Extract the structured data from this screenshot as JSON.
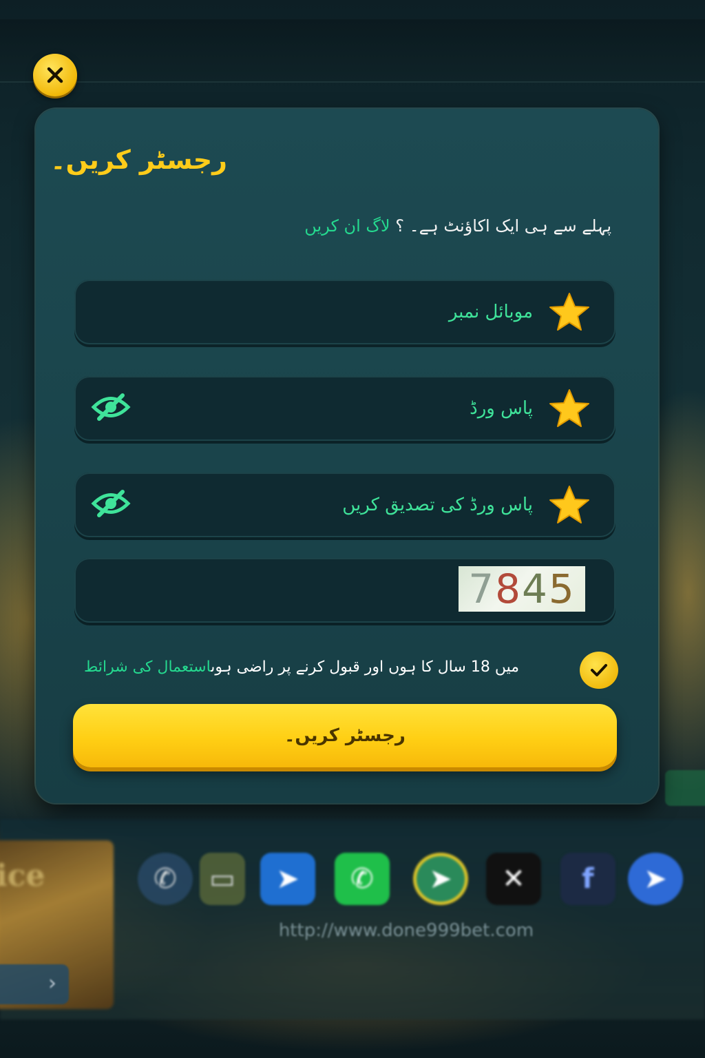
{
  "dialog": {
    "title": "رجسٹر کریں۔",
    "login_prompt": "پہلے سے ہی ایک اکاؤنٹ ہے۔ ؟ ",
    "login_link": "لاگ ان کریں"
  },
  "form": {
    "mobile_placeholder": "موبائل نمبر",
    "password_placeholder": "پاس ورڈ",
    "confirm_password_placeholder": "پاس ورڈ کی تصدیق کریں",
    "captcha_digits": [
      "7",
      "8",
      "4",
      "5"
    ],
    "terms_text": "میں 18 سال کا ہوں اور قبول کرنے پر راضی ہوں",
    "terms_link": "استعمال کی شرائط",
    "terms_checked": true,
    "submit_label": "رجسٹر کریں۔"
  },
  "background": {
    "url": "http://www.done999bet.com",
    "card_text": "ice",
    "social_icons": [
      "viber-icon",
      "video-icon",
      "telegram-icon",
      "whatsapp-icon",
      "telegram-alt-icon",
      "x-icon",
      "facebook-icon",
      "telegram-blue-icon"
    ]
  },
  "colors": {
    "accent_yellow": "#ffcc1a",
    "link_green": "#25d98f",
    "panel": "#1d4a52",
    "field": "#0f2a31"
  }
}
